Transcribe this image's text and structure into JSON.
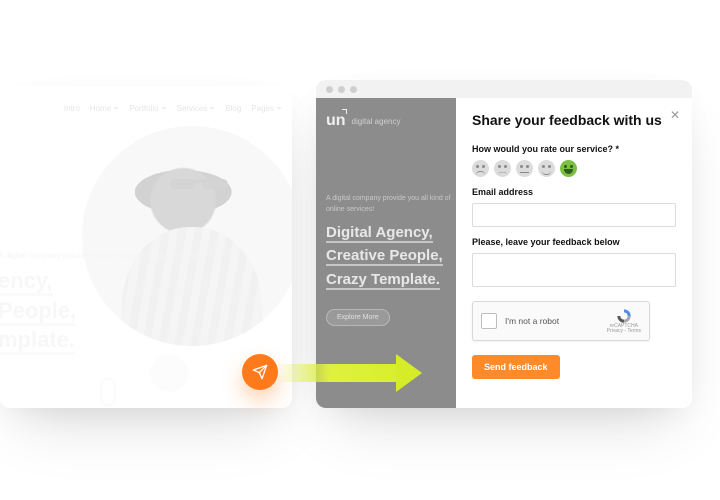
{
  "left": {
    "nav": [
      "Intro",
      "Home",
      "Portfolio",
      "Services",
      "Blog",
      "Pages"
    ],
    "nav_caret_idx": [
      1,
      2,
      3,
      5
    ],
    "intro": "A digital company provide you all kind of online services!",
    "headline_parts": [
      "ency,",
      "People,",
      "mplate."
    ]
  },
  "right": {
    "logo_mark": "un",
    "logo_label": "digital agency",
    "bg_tagline": "A digital company provide you all kind of online services!",
    "bg_headline_lines": [
      "Digital Agency,",
      "Creative People,",
      "Crazy Template."
    ],
    "bg_button": "Explore More",
    "form": {
      "title": "Share your feedback with us",
      "q_rate": "How would you rate our service? *",
      "q_email": "Email address",
      "q_feedback": "Please, leave your feedback below",
      "captcha_text": "I'm not a robot",
      "captcha_brand": "reCAPTCHA",
      "captcha_sub": "Privacy - Terms",
      "submit": "Send feedback",
      "selected_rating_index": 4
    }
  }
}
